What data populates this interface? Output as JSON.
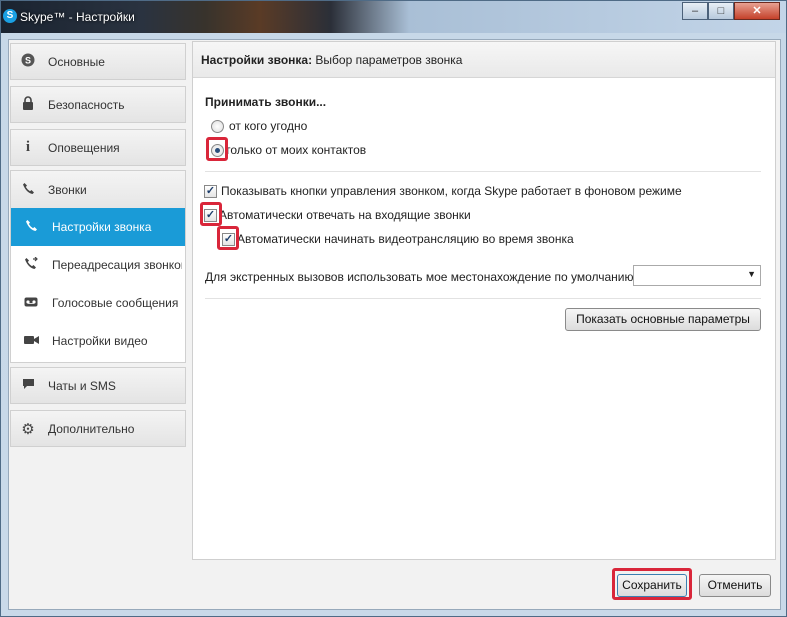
{
  "window": {
    "title": "Skype™ - Настройки",
    "controls": {
      "minimize": "–",
      "maximize": "□",
      "close": "✕"
    }
  },
  "sidebar": {
    "items": [
      {
        "label": "Основные",
        "icon": "skype-icon"
      },
      {
        "label": "Безопасность",
        "icon": "lock-icon"
      },
      {
        "label": "Оповещения",
        "icon": "info-icon"
      }
    ],
    "calls_group": {
      "label": "Звонки",
      "icon": "phone-icon",
      "subitems": [
        {
          "label": "Настройки звонка",
          "icon": "phone-icon",
          "active": true
        },
        {
          "label": "Переадресация звонков",
          "icon": "phone-forward-icon"
        },
        {
          "label": "Голосовые сообщения",
          "icon": "voicemail-icon"
        },
        {
          "label": "Настройки видео",
          "icon": "video-camera-icon"
        }
      ]
    },
    "bottom_items": [
      {
        "label": "Чаты и SMS",
        "icon": "chat-bubble-icon"
      },
      {
        "label": "Дополнительно",
        "icon": "gear-icon"
      }
    ]
  },
  "main": {
    "header_bold": "Настройки звонка:",
    "header_rest": " Выбор параметров звонка",
    "accept_calls_title": "Принимать звонки...",
    "radio_anyone": "от кого угодно",
    "radio_contacts": "только от моих контактов",
    "radio_selected": "contacts",
    "check_show_controls": "Показывать кнопки управления звонком, когда Skype работает в фоновом режиме",
    "check_auto_answer": "Автоматически отвечать на входящие звонки",
    "check_auto_video": "Автоматически начинать видеотрансляцию во время звонка",
    "emergency_label": "Для экстренных вызовов использовать мое местонахождение по умолчанию:",
    "emergency_value": "",
    "show_basic_button": "Показать основные параметры"
  },
  "footer": {
    "save": "Сохранить",
    "cancel": "Отменить"
  },
  "colors": {
    "active_nav": "#1a9bd7",
    "highlight": "#d9263a"
  }
}
